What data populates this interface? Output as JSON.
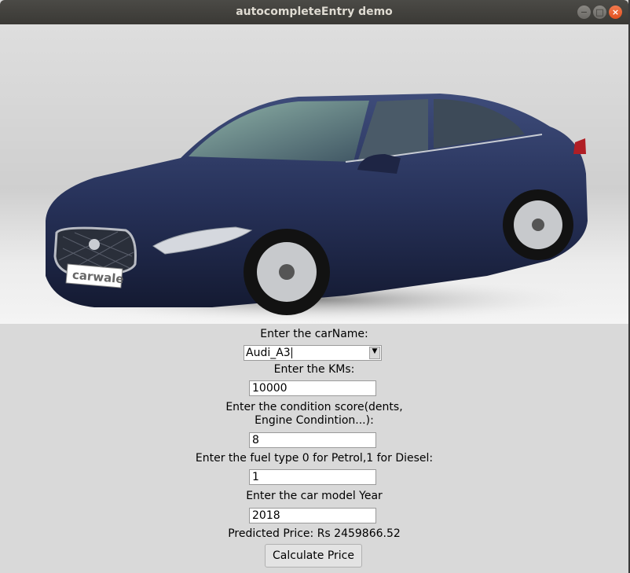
{
  "window": {
    "title": "autocompleteEntry demo"
  },
  "hero": {
    "plate_text": "carwale"
  },
  "form": {
    "car_name_label": "Enter the carName:",
    "car_name_value": "Audi_A3",
    "kms_label": "Enter the KMs:",
    "kms_value": "10000",
    "condition_label_line1": "Enter the condition score(dents,",
    "condition_label_line2": "Engine Condintion...):",
    "condition_value": "8",
    "fuel_label": "Enter the fuel type 0 for Petrol,1 for Diesel:",
    "fuel_value": "1",
    "year_label": "Enter the car model Year",
    "year_value": "2018",
    "prediction_text": "Predicted Price: Rs 2459866.52",
    "calculate_label": "Calculate Price"
  },
  "colors": {
    "close_button": "#e1501f",
    "titlebar": "#3a3935",
    "background": "#d9d9d9"
  }
}
